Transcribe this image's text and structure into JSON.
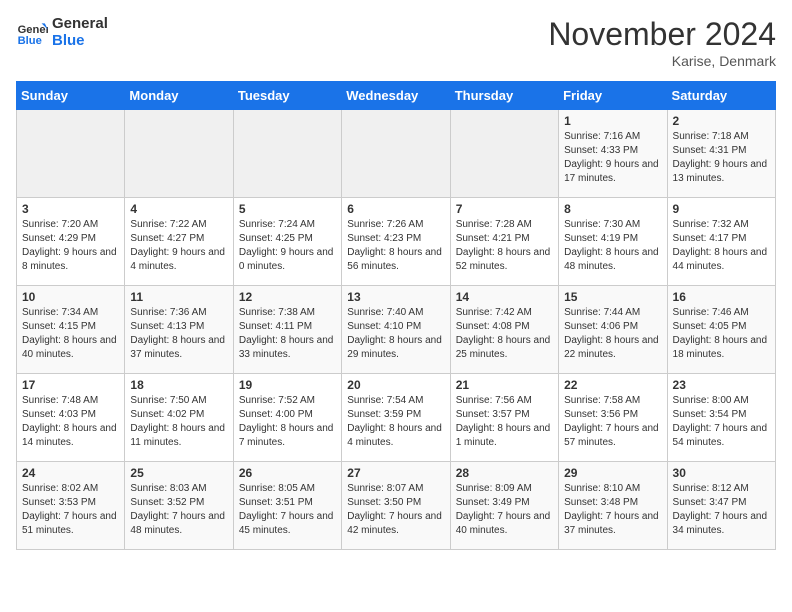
{
  "logo": {
    "line1": "General",
    "line2": "Blue"
  },
  "title": "November 2024",
  "subtitle": "Karise, Denmark",
  "weekdays": [
    "Sunday",
    "Monday",
    "Tuesday",
    "Wednesday",
    "Thursday",
    "Friday",
    "Saturday"
  ],
  "weeks": [
    [
      {
        "day": "",
        "info": ""
      },
      {
        "day": "",
        "info": ""
      },
      {
        "day": "",
        "info": ""
      },
      {
        "day": "",
        "info": ""
      },
      {
        "day": "",
        "info": ""
      },
      {
        "day": "1",
        "info": "Sunrise: 7:16 AM\nSunset: 4:33 PM\nDaylight: 9 hours and 17 minutes."
      },
      {
        "day": "2",
        "info": "Sunrise: 7:18 AM\nSunset: 4:31 PM\nDaylight: 9 hours and 13 minutes."
      }
    ],
    [
      {
        "day": "3",
        "info": "Sunrise: 7:20 AM\nSunset: 4:29 PM\nDaylight: 9 hours and 8 minutes."
      },
      {
        "day": "4",
        "info": "Sunrise: 7:22 AM\nSunset: 4:27 PM\nDaylight: 9 hours and 4 minutes."
      },
      {
        "day": "5",
        "info": "Sunrise: 7:24 AM\nSunset: 4:25 PM\nDaylight: 9 hours and 0 minutes."
      },
      {
        "day": "6",
        "info": "Sunrise: 7:26 AM\nSunset: 4:23 PM\nDaylight: 8 hours and 56 minutes."
      },
      {
        "day": "7",
        "info": "Sunrise: 7:28 AM\nSunset: 4:21 PM\nDaylight: 8 hours and 52 minutes."
      },
      {
        "day": "8",
        "info": "Sunrise: 7:30 AM\nSunset: 4:19 PM\nDaylight: 8 hours and 48 minutes."
      },
      {
        "day": "9",
        "info": "Sunrise: 7:32 AM\nSunset: 4:17 PM\nDaylight: 8 hours and 44 minutes."
      }
    ],
    [
      {
        "day": "10",
        "info": "Sunrise: 7:34 AM\nSunset: 4:15 PM\nDaylight: 8 hours and 40 minutes."
      },
      {
        "day": "11",
        "info": "Sunrise: 7:36 AM\nSunset: 4:13 PM\nDaylight: 8 hours and 37 minutes."
      },
      {
        "day": "12",
        "info": "Sunrise: 7:38 AM\nSunset: 4:11 PM\nDaylight: 8 hours and 33 minutes."
      },
      {
        "day": "13",
        "info": "Sunrise: 7:40 AM\nSunset: 4:10 PM\nDaylight: 8 hours and 29 minutes."
      },
      {
        "day": "14",
        "info": "Sunrise: 7:42 AM\nSunset: 4:08 PM\nDaylight: 8 hours and 25 minutes."
      },
      {
        "day": "15",
        "info": "Sunrise: 7:44 AM\nSunset: 4:06 PM\nDaylight: 8 hours and 22 minutes."
      },
      {
        "day": "16",
        "info": "Sunrise: 7:46 AM\nSunset: 4:05 PM\nDaylight: 8 hours and 18 minutes."
      }
    ],
    [
      {
        "day": "17",
        "info": "Sunrise: 7:48 AM\nSunset: 4:03 PM\nDaylight: 8 hours and 14 minutes."
      },
      {
        "day": "18",
        "info": "Sunrise: 7:50 AM\nSunset: 4:02 PM\nDaylight: 8 hours and 11 minutes."
      },
      {
        "day": "19",
        "info": "Sunrise: 7:52 AM\nSunset: 4:00 PM\nDaylight: 8 hours and 7 minutes."
      },
      {
        "day": "20",
        "info": "Sunrise: 7:54 AM\nSunset: 3:59 PM\nDaylight: 8 hours and 4 minutes."
      },
      {
        "day": "21",
        "info": "Sunrise: 7:56 AM\nSunset: 3:57 PM\nDaylight: 8 hours and 1 minute."
      },
      {
        "day": "22",
        "info": "Sunrise: 7:58 AM\nSunset: 3:56 PM\nDaylight: 7 hours and 57 minutes."
      },
      {
        "day": "23",
        "info": "Sunrise: 8:00 AM\nSunset: 3:54 PM\nDaylight: 7 hours and 54 minutes."
      }
    ],
    [
      {
        "day": "24",
        "info": "Sunrise: 8:02 AM\nSunset: 3:53 PM\nDaylight: 7 hours and 51 minutes."
      },
      {
        "day": "25",
        "info": "Sunrise: 8:03 AM\nSunset: 3:52 PM\nDaylight: 7 hours and 48 minutes."
      },
      {
        "day": "26",
        "info": "Sunrise: 8:05 AM\nSunset: 3:51 PM\nDaylight: 7 hours and 45 minutes."
      },
      {
        "day": "27",
        "info": "Sunrise: 8:07 AM\nSunset: 3:50 PM\nDaylight: 7 hours and 42 minutes."
      },
      {
        "day": "28",
        "info": "Sunrise: 8:09 AM\nSunset: 3:49 PM\nDaylight: 7 hours and 40 minutes."
      },
      {
        "day": "29",
        "info": "Sunrise: 8:10 AM\nSunset: 3:48 PM\nDaylight: 7 hours and 37 minutes."
      },
      {
        "day": "30",
        "info": "Sunrise: 8:12 AM\nSunset: 3:47 PM\nDaylight: 7 hours and 34 minutes."
      }
    ]
  ]
}
